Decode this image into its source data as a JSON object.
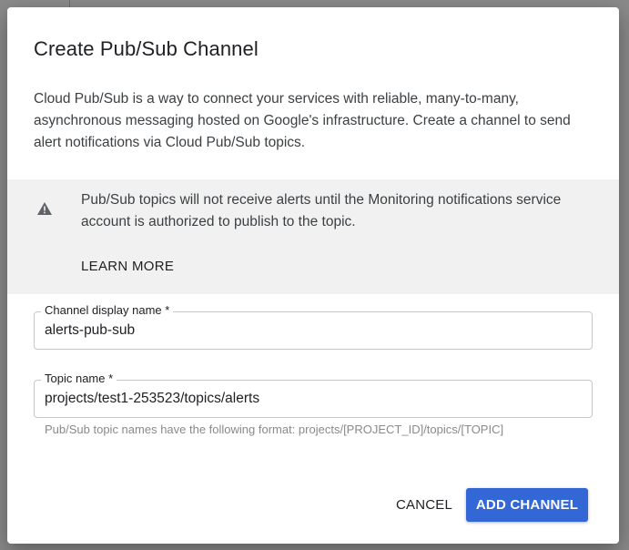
{
  "dialog": {
    "title": "Create Pub/Sub Channel",
    "description": "Cloud Pub/Sub is a way to connect your services with reliable, many-to-many, asynchronous messaging hosted on Google's infrastructure. Create a channel to send alert notifications via Cloud Pub/Sub topics."
  },
  "warning": {
    "icon": "warning-icon",
    "text": "Pub/Sub topics will not receive alerts until the Monitoring notifications service account is authorized to publish to the topic.",
    "learn_more": "LEARN MORE"
  },
  "fields": {
    "channel_name": {
      "label": "Channel display name *",
      "value": "alerts-pub-sub"
    },
    "topic_name": {
      "label": "Topic name *",
      "value": "projects/test1-253523/topics/alerts",
      "hint": "Pub/Sub topic names have the following format: projects/[PROJECT_ID]/topics/[TOPIC]"
    }
  },
  "actions": {
    "cancel": "CANCEL",
    "add": "ADD CHANNEL"
  },
  "colors": {
    "primary": "#3367d6",
    "warning_bg": "#f1f1f1",
    "overlay": "#7f7f7f"
  }
}
